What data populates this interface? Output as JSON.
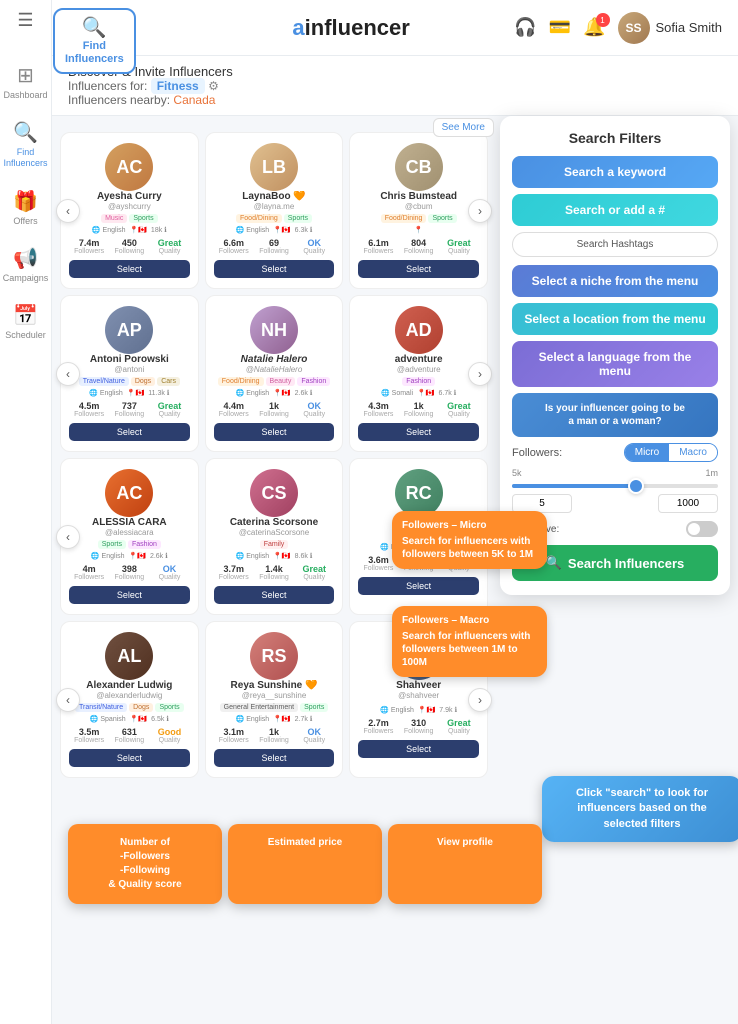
{
  "app": {
    "name": "ainfluencer",
    "logo_ai": "a",
    "logo_rest": "influencer"
  },
  "header": {
    "search_btn": "Search",
    "user_name": "Sofia Smith",
    "notif_count": "1"
  },
  "sidebar": {
    "menu_icon": "☰",
    "items": [
      {
        "id": "dashboard",
        "label": "Dashboard",
        "icon": "⊞"
      },
      {
        "id": "find",
        "label": "Find Influencers",
        "icon": "🔍",
        "active": true
      },
      {
        "id": "offers",
        "label": "Offers",
        "icon": "🎁"
      },
      {
        "id": "campaigns",
        "label": "Campaigns",
        "icon": "📢"
      },
      {
        "id": "scheduler",
        "label": "Scheduler",
        "icon": "📅"
      }
    ]
  },
  "find_btn": {
    "icon": "🔍",
    "label": "Find\nInfluencers"
  },
  "page": {
    "discover_title": "Discover & Invite Influencers",
    "influencers_for_label": "Influencers for:",
    "influencers_for_value": "Fitness",
    "nearby_label": "Influencers nearby:",
    "nearby_value": "Canada",
    "see_more": "See More"
  },
  "influencers": [
    {
      "name": "Ayesha Curry",
      "handle": "@ayshcurry",
      "tags": [
        "Music",
        "Sports"
      ],
      "lang": "English",
      "country": "🇨🇦",
      "country_name": "Canada",
      "followers_k": "18k",
      "stats": {
        "followers": "7.4m",
        "following": "450",
        "quality": "Great"
      },
      "color": "#c8a87a"
    },
    {
      "name": "LaynaBoo 🧡",
      "handle": "@layna.me",
      "tags": [
        "Food/Dining",
        "Sports"
      ],
      "lang": "English",
      "country": "🇨🇦",
      "country_name": "Canada",
      "followers_k": "6.3k",
      "stats": {
        "followers": "6.6m",
        "following": "69",
        "quality": "OK"
      },
      "color": "#e0a080"
    },
    {
      "name": "Chris Bumstead",
      "handle": "@cbum",
      "tags": [
        "Food/Dining",
        "Sports"
      ],
      "lang": "",
      "country": "",
      "country_name": "",
      "followers_k": "",
      "stats": {
        "followers": "6.1m",
        "following": "804",
        "quality": "Great"
      },
      "color": "#d4c0a0"
    },
    {
      "name": "Antoni Porowski",
      "handle": "@antoni",
      "tags": [
        "Travel/Nature",
        "Dogs",
        "Cars"
      ],
      "lang": "English",
      "country": "🇨🇦",
      "country_name": "Canada",
      "followers_k": "11.3k",
      "stats": {
        "followers": "4.5m",
        "following": "737",
        "quality": "Great"
      },
      "color": "#8090b0"
    },
    {
      "name": "Natalie Halero",
      "handle": "@NatalieHalero",
      "tags": [
        "Food/Dining",
        "Beauty",
        "Fashion"
      ],
      "lang": "English",
      "country": "🇨🇦",
      "country_name": "Canada",
      "followers_k": "2.6k",
      "stats": {
        "followers": "4.4m",
        "following": "1k",
        "quality": "OK"
      },
      "color": "#b0a0c0"
    },
    {
      "name": "ALESSIA CARA",
      "handle": "@alessiacara",
      "tags": [
        "Sports",
        "Fashion"
      ],
      "lang": "English",
      "country": "🇨🇦",
      "country_name": "Canada",
      "followers_k": "2.6k",
      "stats": {
        "followers": "4m",
        "following": "398",
        "quality": "OK"
      },
      "color": "#e87030"
    },
    {
      "name": "Caterina Scorsone",
      "handle": "@caterinaScorsone",
      "tags": [
        "Family"
      ],
      "lang": "English",
      "country": "🇨🇦",
      "country_name": "Canada",
      "followers_k": "8.6k",
      "stats": {
        "followers": "3.7m",
        "following": "1.4k",
        "quality": "Great"
      },
      "color": "#c07090"
    },
    {
      "name": "Alexander Ludwig",
      "handle": "@alexanderludwig",
      "tags": [
        "Transit/Nature",
        "Dogs",
        "Sports"
      ],
      "lang": "Spanish",
      "country": "🇨🇦",
      "country_name": "Canada",
      "followers_k": "6.5k",
      "stats": {
        "followers": "3.5m",
        "following": "631",
        "quality": "Good"
      },
      "color": "#705040"
    },
    {
      "name": "Reya Sunshine 🧡",
      "handle": "@reya__sunshine",
      "tags": [
        "General Entertainment",
        "Sports"
      ],
      "lang": "English",
      "country": "🇨🇦",
      "country_name": "Canada",
      "followers_k": "2.7k",
      "stats": {
        "followers": "3.1m",
        "following": "1k",
        "quality": "OK"
      },
      "color": "#d4807a"
    },
    {
      "name": "Shahveer",
      "handle": "@shahveer",
      "tags": [],
      "lang": "English",
      "country": "🇨🇦",
      "country_name": "Canada",
      "followers_k": "7.9k",
      "stats": {
        "followers": "2.7m",
        "following": "310",
        "quality": "Great"
      },
      "color": "#6080a0"
    }
  ],
  "search_filters": {
    "title": "Search Filters",
    "keyword_btn": "Search a keyword",
    "add_hash_btn": "Search or add a #",
    "search_hashtags_btn": "Search Hashtags",
    "niche_btn": "Select a niche from the menu",
    "location_btn": "Select a location from the menu",
    "language_btn": "Select a language from the menu",
    "gender_btn": "Is your influencer going to be\na man or a woman?",
    "followers_label": "Followers:",
    "micro_label": "Micro",
    "macro_label": "Macro",
    "range_min": "5k",
    "range_max": "1m",
    "range_low": "5",
    "range_high": "1000",
    "auto_save_label": "Auto save:",
    "search_btn": "Search Influencers"
  },
  "tooltips": {
    "micro": {
      "title": "Followers – Micro",
      "body": "Search for influencers with followers between 5K to 1M"
    },
    "macro": {
      "title": "Followers – Macro",
      "body": "Search for influencers with followers between 1M to 100M"
    },
    "click_search": {
      "body": "Click \"search\" to look for influencers based on the selected filters"
    }
  },
  "callouts": {
    "stats_label": "Number of\n-Followers\n-Following\n& Quality score",
    "price_label": "Estimated price",
    "view_profile_label": "View profile"
  }
}
